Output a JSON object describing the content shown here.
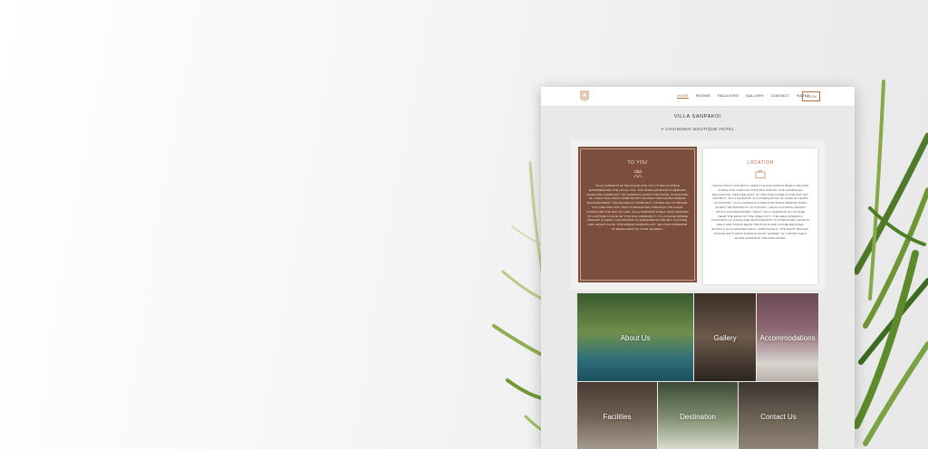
{
  "nav": {
    "links": [
      "HOME",
      "ROOMS",
      "FACILITIES",
      "GALLERY",
      "CONTACT",
      "RATES"
    ],
    "book": "BOOK"
  },
  "hero": {
    "title": "VILLA SANPAKOI",
    "subtitle": "A CHIANGMAI BOUTIQUE HOTEL"
  },
  "card_you": {
    "title": "TO YOU",
    "body": "VILLA SANPAKOI IS THE PLACE FOR YOU TO RELAX WHILE EXPERIENCING THE LOCAL LIFE. THE NAME SANPAKOI IS DERIVED FROM THE COMMUNITY OF SANPAKOI WHICH THE HOTEL IS SITUATED IN, A MULTICULTURAL ZONE WHICH HOUSES THEM FROM DIVERSE BACKGROUNDS. THE PEACEFUL COMMUNITY OF WAT KET IS UNIQUE. IT'S A MELTING POT THAT IS REFLECTED THROUGH THE LOCAL FOODS AND THE WAY OF LIFE. VILLA SANPAKOI ITSELF WAS CRAFTED TO CAPTURE A SLICE OF THIS OLD COMMUNITY. IT'S A PLACE WHERE FRIENDS & FAMILY CAN ESCAPE TO EXPERIENCE THE ART, CULTURE, AND LIFESTYLE OF THIS WORLD-FAMOUS CITY. WE LOOK FORWARD TO BEING PART OF YOUR JOURNEY."
  },
  "card_location": {
    "title": "LOCATION",
    "body": "CHIANG MAI'S LAID-BACK LIFESTYLE HAS ALWAYS BEEN A DRIVING FORCE FOR CURIOUS VISITORS HUNGRY FOR UNSPOILED RELAXATION. NESTLED EAST OF THE PING RIVER IN THE WAT KET DISTRICT, VILLA SANPAKOI IS A COMPILATION OF OVER 50 YEARS OF HISTORY. VILLA SANPAKOI'S ARCHITECTURAL DESIGN TAKES AFTER THE DISTRICT'S 'OUTGOING' LANNA-COLONIAL DESIGN WITH A CONTEMPORARY TWIST. VILLA SANPAKOI IS LOCATED NEAR THE EDGE OF THE INNER CITY. THE AREA OFFERS A PLETHORA OF CAFES AND RESTAURANTS TO OVERCOME VARIOUS WALK AND SHOPS NEAR THE PING RIVER CAN BE REACHED WITHIN A 10-15 MINUTES WALK. ADDITIONALLY THE NIGHT BAZAAR, CHIANG MAI'S MOST FAMOUS NIGHT MARKET, IS A SHORT WALK AFTER CROSSING THE PING RIVER."
  },
  "tiles": [
    "About Us",
    "Gallery",
    "Accommodations",
    "Facilities",
    "Destination",
    "Contact Us"
  ],
  "colors": {
    "accent": "#b0703f",
    "card_brown": "#7b4e3d"
  }
}
